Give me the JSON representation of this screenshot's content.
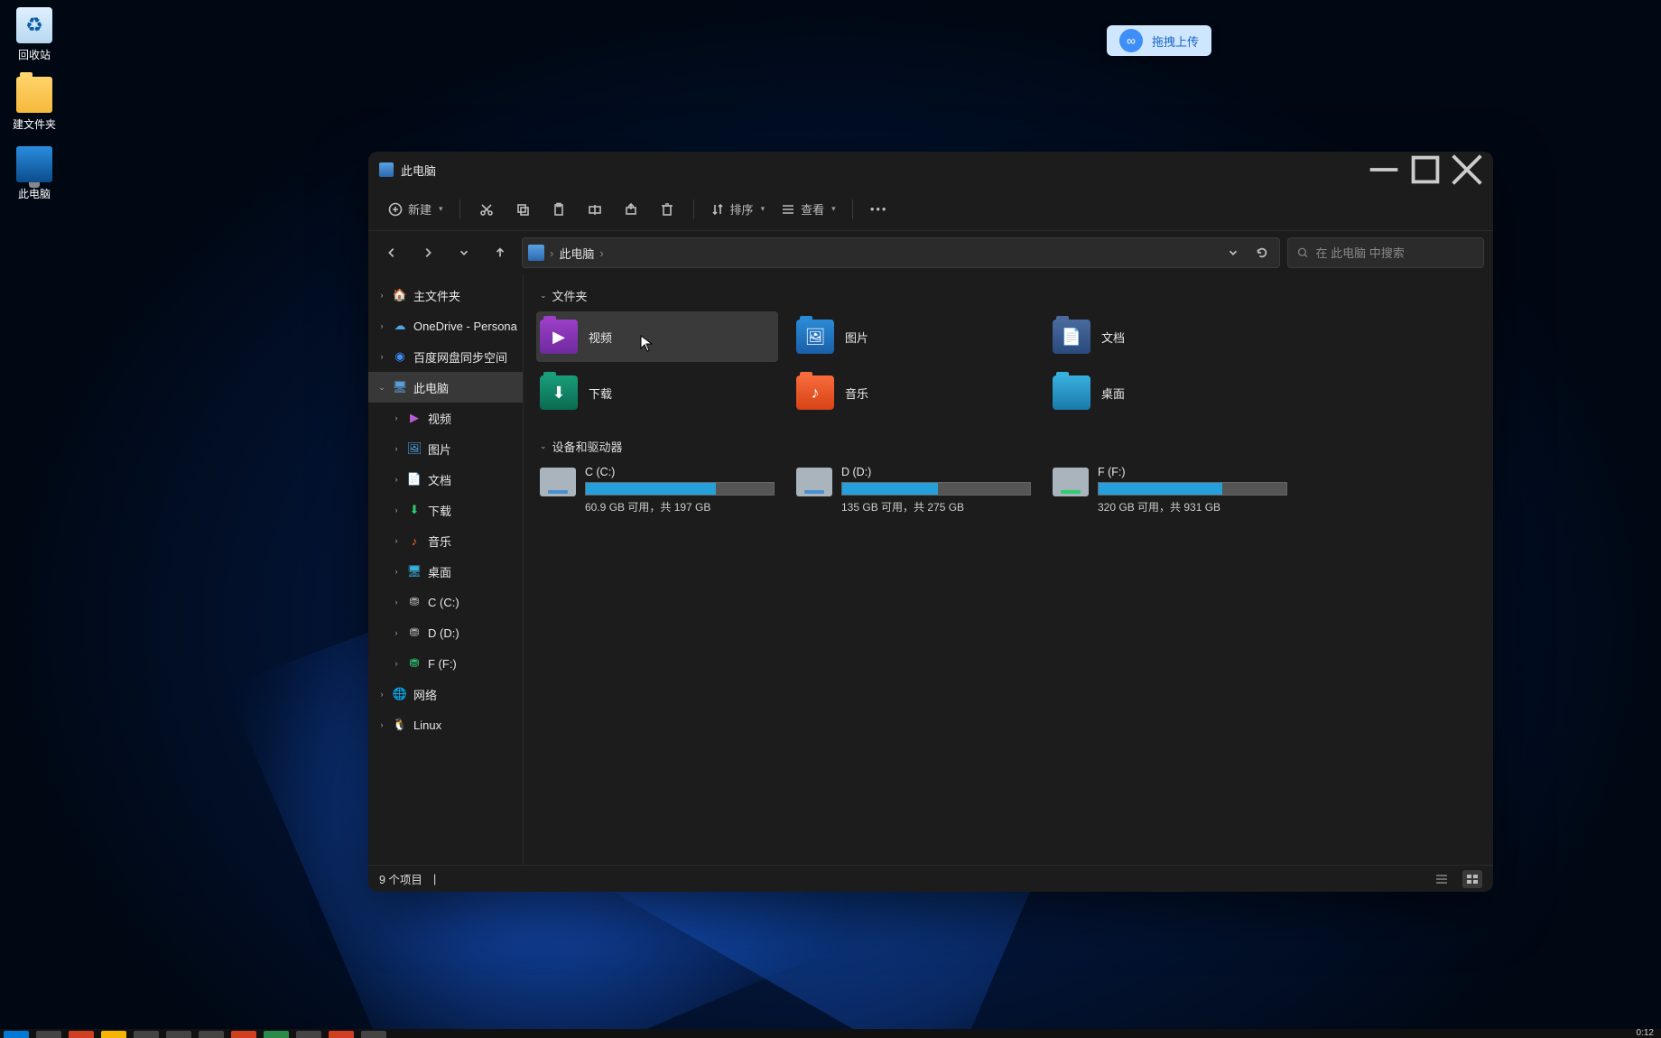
{
  "desktop": {
    "icons": [
      {
        "name": "回收站"
      },
      {
        "name": "建文件夹"
      },
      {
        "name": "此电脑"
      }
    ]
  },
  "baidu_drag": {
    "label": "拖拽上传"
  },
  "window": {
    "title": "此电脑",
    "toolbar": {
      "new": "新建",
      "sort": "排序",
      "view": "查看"
    },
    "breadcrumb": {
      "root": "此电脑"
    },
    "search_placeholder": "在 此电脑 中搜索",
    "sidebar": {
      "home": "主文件夹",
      "onedrive": "OneDrive - Persona",
      "baidu": "百度网盘同步空间",
      "thispc": "此电脑",
      "videos": "视频",
      "pictures": "图片",
      "documents": "文档",
      "downloads": "下载",
      "music": "音乐",
      "desktop": "桌面",
      "drive_c": "C (C:)",
      "drive_d": "D (D:)",
      "drive_f": "F (F:)",
      "network": "网络",
      "linux": "Linux"
    },
    "sections": {
      "folders": "文件夹",
      "drives": "设备和驱动器"
    },
    "folders": {
      "videos": "视频",
      "pictures": "图片",
      "documents": "文档",
      "downloads": "下载",
      "music": "音乐",
      "desktop": "桌面"
    },
    "drives": [
      {
        "name": "C (C:)",
        "free": "60.9 GB 可用，共 197 GB",
        "pct": 69
      },
      {
        "name": "D (D:)",
        "free": "135 GB 可用，共 275 GB",
        "pct": 51
      },
      {
        "name": "F (F:)",
        "free": "320 GB 可用，共 931 GB",
        "pct": 66
      }
    ],
    "status": "9 个项目"
  },
  "clock": "0:12"
}
